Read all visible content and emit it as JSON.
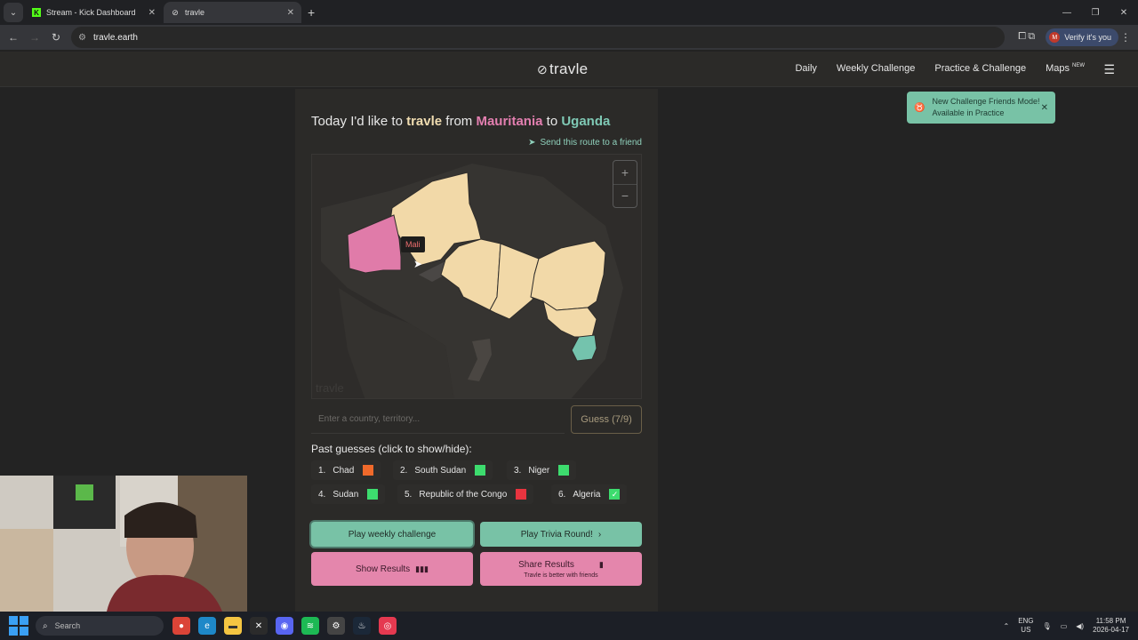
{
  "browser": {
    "tabs": [
      {
        "title": "Stream - Kick Dashboard",
        "icon": "kick-icon"
      },
      {
        "title": "travle",
        "icon": "compass-icon"
      }
    ],
    "url": "travle.earth",
    "verify_label": "Verify it's you",
    "profile_initial": "M"
  },
  "site": {
    "logo": "travle",
    "nav": {
      "daily": "Daily",
      "weekly": "Weekly Challenge",
      "practice": "Practice & Challenge",
      "maps": "Maps",
      "maps_badge": "NEW"
    },
    "toast": {
      "line1": "New Challenge Friends Mode!",
      "line2": "Available in Practice"
    },
    "headline": {
      "pre": "Today I'd like to",
      "brand": "travle",
      "from_word": "from",
      "from": "Mauritania",
      "to_word": "to",
      "to": "Uganda"
    },
    "send_route": "Send this route to a friend",
    "map": {
      "tooltip": "Mali",
      "watermark": "travle",
      "zoom_in": "+",
      "zoom_out": "−",
      "colors": {
        "start": "#e07ba9",
        "end": "#74c3ad",
        "guessed": "#f2d9a8",
        "land": "#363431",
        "hover": "#4a4745"
      }
    },
    "guess": {
      "placeholder": "Enter a country, territory...",
      "button": "Guess (7/9)"
    },
    "past_guesses_label": "Past guesses (click to show/hide):",
    "past_guesses": [
      {
        "num": "1.",
        "name": "Chad",
        "color": "#f06a2b",
        "mark": ""
      },
      {
        "num": "2.",
        "name": "South Sudan",
        "color": "#3ddc6e",
        "mark": ""
      },
      {
        "num": "3.",
        "name": "Niger",
        "color": "#3ddc6e",
        "mark": ""
      },
      {
        "num": "4.",
        "name": "Sudan",
        "color": "#3ddc6e",
        "mark": ""
      },
      {
        "num": "5.",
        "name": "Republic of the Congo",
        "color": "#e8343f",
        "mark": ""
      },
      {
        "num": "6.",
        "name": "Algeria",
        "color": "#3ddc6e",
        "mark": "✓"
      }
    ],
    "buttons": {
      "weekly": "Play weekly challenge",
      "trivia": "Play Trivia Round!",
      "show_results": "Show Results",
      "share": "Share Results",
      "share_sub": "Travle is better with friends"
    }
  },
  "taskbar": {
    "search": "Search",
    "lang1": "ENG",
    "lang2": "US",
    "time": "11:58 PM",
    "date": "2026-04-17"
  }
}
